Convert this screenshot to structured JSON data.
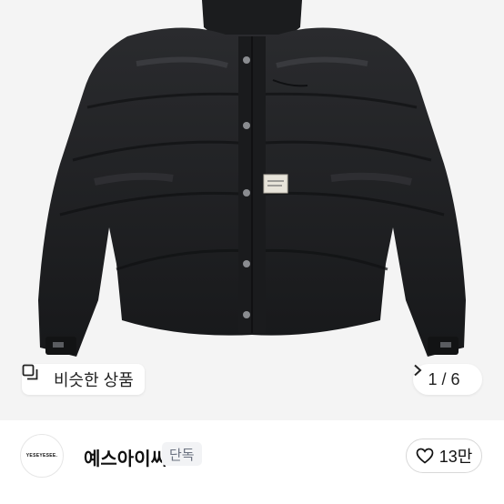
{
  "gallery": {
    "similar_label": "비슷한 상품",
    "current": "1",
    "separator": "/",
    "total": "6"
  },
  "seller": {
    "avatar_text": "YESEYESEE.",
    "name": "예스아이씨",
    "badge": "단독"
  },
  "likes": {
    "count": "13만"
  },
  "colors": {
    "jacket": "#1f2022",
    "background": "#f4f4f4",
    "badge_bg": "#f2f3f5",
    "badge_text": "#6b7280"
  }
}
